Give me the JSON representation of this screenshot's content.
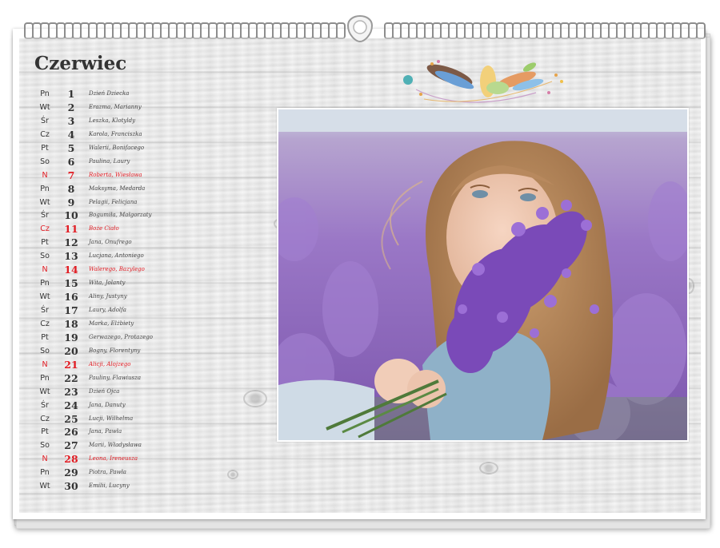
{
  "calendar": {
    "month": "Czerwiec",
    "days": [
      {
        "dow": "Pn",
        "num": "1",
        "names": "Dzień Dziecka",
        "holiday": false
      },
      {
        "dow": "Wt",
        "num": "2",
        "names": "Erazma, Marianny",
        "holiday": false
      },
      {
        "dow": "Śr",
        "num": "3",
        "names": "Leszka, Klotyldy",
        "holiday": false
      },
      {
        "dow": "Cz",
        "num": "4",
        "names": "Karola, Franciszka",
        "holiday": false
      },
      {
        "dow": "Pt",
        "num": "5",
        "names": "Walerii, Bonifacego",
        "holiday": false
      },
      {
        "dow": "So",
        "num": "6",
        "names": "Paulina, Laury",
        "holiday": false
      },
      {
        "dow": "N",
        "num": "7",
        "names": "Roberta, Wiesława",
        "holiday": true
      },
      {
        "dow": "Pn",
        "num": "8",
        "names": "Maksyma, Medarda",
        "holiday": false
      },
      {
        "dow": "Wt",
        "num": "9",
        "names": "Pelagii, Felicjana",
        "holiday": false
      },
      {
        "dow": "Śr",
        "num": "10",
        "names": "Bogumiła, Małgorzaty",
        "holiday": false
      },
      {
        "dow": "Cz",
        "num": "11",
        "names": "Boże Ciało",
        "holiday": true
      },
      {
        "dow": "Pt",
        "num": "12",
        "names": "Jana, Onufrego",
        "holiday": false
      },
      {
        "dow": "So",
        "num": "13",
        "names": "Lucjana, Antoniego",
        "holiday": false
      },
      {
        "dow": "N",
        "num": "14",
        "names": "Walerego, Bazylego",
        "holiday": true
      },
      {
        "dow": "Pn",
        "num": "15",
        "names": "Wita, Jolanty",
        "holiday": false
      },
      {
        "dow": "Wt",
        "num": "16",
        "names": "Aliny, Justyny",
        "holiday": false
      },
      {
        "dow": "Śr",
        "num": "17",
        "names": "Laury, Adolfa",
        "holiday": false
      },
      {
        "dow": "Cz",
        "num": "18",
        "names": "Marka, Elżbiety",
        "holiday": false
      },
      {
        "dow": "Pt",
        "num": "19",
        "names": "Gerwazego, Protazego",
        "holiday": false
      },
      {
        "dow": "So",
        "num": "20",
        "names": "Bogny, Florentyny",
        "holiday": false
      },
      {
        "dow": "N",
        "num": "21",
        "names": "Alicji, Alojzego",
        "holiday": true
      },
      {
        "dow": "Pn",
        "num": "22",
        "names": "Pauliny, Flawiusza",
        "holiday": false
      },
      {
        "dow": "Wt",
        "num": "23",
        "names": "Dzień Ojca",
        "holiday": false
      },
      {
        "dow": "Śr",
        "num": "24",
        "names": "Jana, Danuty",
        "holiday": false
      },
      {
        "dow": "Cz",
        "num": "25",
        "names": "Lucji, Wilhelma",
        "holiday": false
      },
      {
        "dow": "Pt",
        "num": "26",
        "names": "Jana, Pawła",
        "holiday": false
      },
      {
        "dow": "So",
        "num": "27",
        "names": "Marii, Władysława",
        "holiday": false
      },
      {
        "dow": "N",
        "num": "28",
        "names": "Leona, Ireneusza",
        "holiday": true
      },
      {
        "dow": "Pn",
        "num": "29",
        "names": "Piotra, Pawła",
        "holiday": false
      },
      {
        "dow": "Wt",
        "num": "30",
        "names": "Emilii, Lucyny",
        "holiday": false
      }
    ]
  },
  "colors": {
    "holiday": "#e11b22",
    "text": "#333333",
    "lavender": "#8e6bc4",
    "wood": "#e9e9e9"
  },
  "icons": {
    "binding": "spiral-binding-icon",
    "hanger": "hanger-hook-icon",
    "decoration": "feathers-decoration-icon"
  }
}
